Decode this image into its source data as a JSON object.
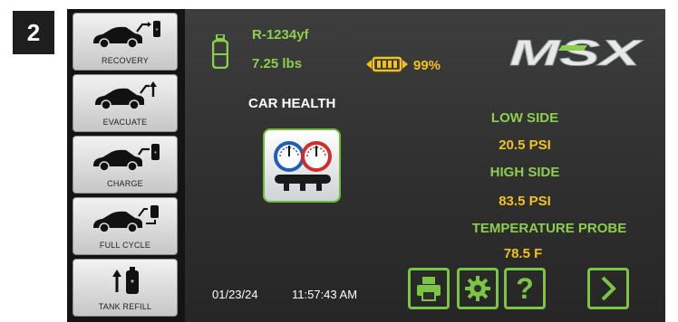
{
  "step": {
    "number": "2"
  },
  "sidebar": {
    "items": [
      {
        "label": "RECOVERY",
        "icon": "car-recovery-icon"
      },
      {
        "label": "EVACUATE",
        "icon": "car-evacuate-icon"
      },
      {
        "label": "CHARGE",
        "icon": "car-charge-icon"
      },
      {
        "label": "FULL CYCLE",
        "icon": "car-full-cycle-icon"
      },
      {
        "label": "TANK REFILL",
        "icon": "tank-refill-icon"
      }
    ]
  },
  "status": {
    "refrigerant": "R-1234yf",
    "weight": "7.25 lbs",
    "battery": "99%"
  },
  "logo": {
    "text": "MSX"
  },
  "car_health": {
    "title": "CAR HEALTH"
  },
  "readings": {
    "low_side_label": "LOW SIDE",
    "low_side_value": "20.5 PSI",
    "high_side_label": "HIGH SIDE",
    "high_side_value": "83.5 PSI",
    "probe_label": "TEMPERATURE PROBE",
    "probe_value": "78.5 F"
  },
  "footer": {
    "date": "01/23/24",
    "time": "11:57:43 AM"
  },
  "colors": {
    "accent_green": "#7cc443",
    "value_yellow": "#f3c21a",
    "screen_bg": "#333333"
  }
}
